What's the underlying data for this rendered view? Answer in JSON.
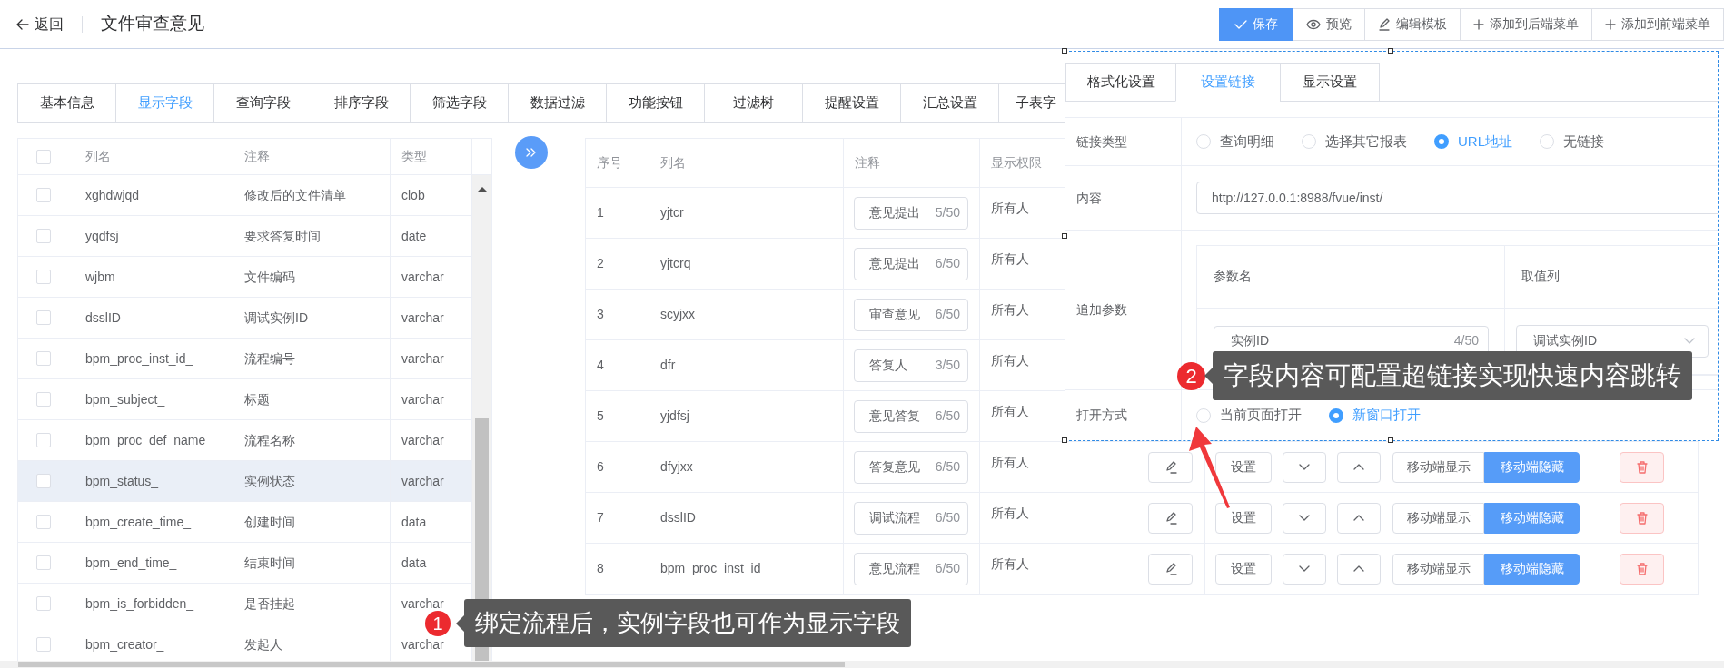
{
  "header": {
    "back": "返回",
    "title": "文件审查意见",
    "buttons": [
      {
        "label": "保存",
        "kind": "save"
      },
      {
        "label": "预览",
        "kind": "preview"
      },
      {
        "label": "编辑模板",
        "kind": "edit"
      },
      {
        "label": "添加到后端菜单",
        "kind": "add"
      },
      {
        "label": "添加到前端菜单",
        "kind": "add"
      }
    ]
  },
  "tabs": [
    {
      "label": "基本信息",
      "selected": false
    },
    {
      "label": "显示字段",
      "selected": true
    },
    {
      "label": "查询字段",
      "selected": false
    },
    {
      "label": "排序字段",
      "selected": false
    },
    {
      "label": "筛选字段",
      "selected": false
    },
    {
      "label": "数据过滤",
      "selected": false
    },
    {
      "label": "功能按钮",
      "selected": false
    },
    {
      "label": "过滤树",
      "selected": false
    },
    {
      "label": "提醒设置",
      "selected": false
    },
    {
      "label": "汇总设置",
      "selected": false
    },
    {
      "label": "子表字",
      "selected": false
    }
  ],
  "field_table": {
    "select_all": {
      "checked": false
    },
    "columns": [
      "列名",
      "注释",
      "类型"
    ],
    "rows": [
      {
        "name": "xghdwjqd",
        "comment": "修改后的文件清单",
        "type": "clob",
        "checked": false,
        "highlighted": false
      },
      {
        "name": "yqdfsj",
        "comment": "要求答复时间",
        "type": "date",
        "checked": false,
        "highlighted": false
      },
      {
        "name": "wjbm",
        "comment": "文件编码",
        "type": "varchar",
        "checked": false,
        "highlighted": false
      },
      {
        "name": "dsslID",
        "comment": "调试实例ID",
        "type": "varchar",
        "checked": false,
        "highlighted": false
      },
      {
        "name": "bpm_proc_inst_id_",
        "comment": "流程编号",
        "type": "varchar",
        "checked": false,
        "highlighted": false
      },
      {
        "name": "bpm_subject_",
        "comment": "标题",
        "type": "varchar",
        "checked": false,
        "highlighted": false
      },
      {
        "name": "bpm_proc_def_name_",
        "comment": "流程名称",
        "type": "varchar",
        "checked": false,
        "highlighted": false
      },
      {
        "name": "bpm_status_",
        "comment": "实例状态",
        "type": "varchar",
        "checked": false,
        "highlighted": true
      },
      {
        "name": "bpm_create_time_",
        "comment": "创建时间",
        "type": "data",
        "checked": false,
        "highlighted": false
      },
      {
        "name": "bpm_end_time_",
        "comment": "结束时间",
        "type": "data",
        "checked": false,
        "highlighted": false
      },
      {
        "name": "bpm_is_forbidden_",
        "comment": "是否挂起",
        "type": "varchar",
        "checked": false,
        "highlighted": false
      },
      {
        "name": "bpm_creator_",
        "comment": "发起人",
        "type": "varchar",
        "checked": false,
        "highlighted": false
      }
    ]
  },
  "display_table": {
    "columns": [
      "序号",
      "列名",
      "注释",
      "显示权限"
    ],
    "rows": [
      {
        "index": "1",
        "name": "yjtcr",
        "comment": "意见提出",
        "count": "5/50",
        "permission": "所有人"
      },
      {
        "index": "2",
        "name": "yjtcrq",
        "comment": "意见提出",
        "count": "6/50",
        "permission": "所有人"
      },
      {
        "index": "3",
        "name": "scyjxx",
        "comment": "审查意见",
        "count": "6/50",
        "permission": "所有人"
      },
      {
        "index": "4",
        "name": "dfr",
        "comment": "答复人",
        "count": "3/50",
        "permission": "所有人"
      },
      {
        "index": "5",
        "name": "yjdfsj",
        "comment": "意见答复",
        "count": "6/50",
        "permission": "所有人"
      },
      {
        "index": "6",
        "name": "dfyjxx",
        "comment": "答复意见",
        "count": "6/50",
        "permission": "所有人",
        "actions": {
          "setting": "设置",
          "mobile": [
            {
              "label": "移动端显示",
              "selected": false
            },
            {
              "label": "移动端隐藏",
              "selected": true
            }
          ]
        }
      },
      {
        "index": "7",
        "name": "dsslID",
        "comment": "调试流程",
        "count": "6/50",
        "permission": "所有人",
        "actions": {
          "setting": "设置",
          "mobile": [
            {
              "label": "移动端显示",
              "selected": false
            },
            {
              "label": "移动端隐藏",
              "selected": true
            }
          ]
        }
      },
      {
        "index": "8",
        "name": "bpm_proc_inst_id_",
        "comment": "意见流程",
        "count": "6/50",
        "permission": "所有人",
        "actions": {
          "setting": "设置",
          "mobile": [
            {
              "label": "移动端显示",
              "selected": false
            },
            {
              "label": "移动端隐藏",
              "selected": true
            }
          ]
        }
      }
    ]
  },
  "link_panel": {
    "tabs": [
      {
        "label": "格式化设置",
        "selected": false
      },
      {
        "label": "设置链接",
        "selected": true
      },
      {
        "label": "显示设置",
        "selected": false
      }
    ],
    "link_type": {
      "label": "链接类型",
      "options": [
        {
          "label": "查询明细",
          "selected": false
        },
        {
          "label": "选择其它报表",
          "selected": false
        },
        {
          "label": "URL地址",
          "selected": true
        },
        {
          "label": "无链接",
          "selected": false
        }
      ]
    },
    "content": {
      "label": "内容",
      "value": "http://127.0.0.1:8988/fvue/inst/"
    },
    "params": {
      "label": "追加参数",
      "columns": [
        "参数名",
        "取值列"
      ],
      "rows": [
        {
          "name": "实例ID",
          "count": "4/50",
          "column": "调试实例ID"
        }
      ]
    },
    "open_mode": {
      "label": "打开方式",
      "options": [
        {
          "label": "当前页面打开",
          "selected": false
        },
        {
          "label": "新窗口打开",
          "selected": true
        }
      ]
    }
  },
  "callouts": [
    {
      "number": "1",
      "text": "绑定流程后，实例字段也可作为显示字段"
    },
    {
      "number": "2",
      "text": "字段内容可配置超链接实现快速内容跳转"
    }
  ]
}
